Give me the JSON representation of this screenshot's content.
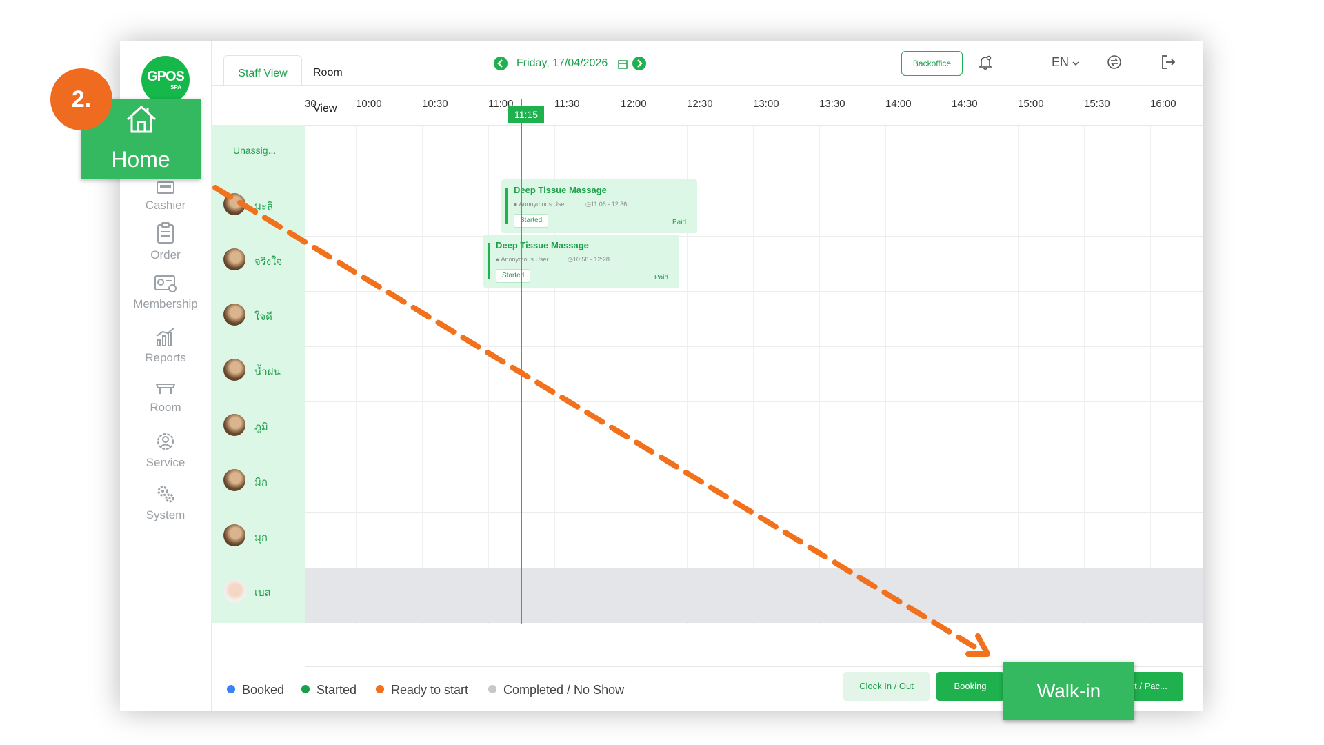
{
  "app": {
    "logo_text": "GPOS",
    "logo_sub": "SPA"
  },
  "sidebar": {
    "items": [
      {
        "label": "Home",
        "icon": "home-icon"
      },
      {
        "label": "Cashier",
        "icon": "cashier-icon"
      },
      {
        "label": "Order",
        "icon": "clipboard-icon"
      },
      {
        "label": "Membership",
        "icon": "membership-card-icon"
      },
      {
        "label": "Reports",
        "icon": "chart-icon"
      },
      {
        "label": "Room",
        "icon": "massage-bed-icon"
      },
      {
        "label": "Service",
        "icon": "service-icon"
      },
      {
        "label": "System",
        "icon": "gears-icon"
      }
    ]
  },
  "header": {
    "tabs": [
      {
        "label": "Staff View",
        "active": true
      },
      {
        "label": "Room View",
        "active": false
      }
    ],
    "date": "Friday, 17/04/2026",
    "backoffice_label": "Backoffice",
    "language": "EN"
  },
  "timeline": {
    "labels": [
      "30",
      "10:00",
      "10:30",
      "11:00",
      "11:30",
      "12:00",
      "12:30",
      "13:00",
      "13:30",
      "14:00",
      "14:30",
      "15:00",
      "15:30",
      "16:00"
    ],
    "current_time": "11:15"
  },
  "staff": {
    "unassigned_label": "Unassig...",
    "members": [
      "มะลิ",
      "จริงใจ",
      "ใจดี",
      "น้ำฝน",
      "ภูมิ",
      "มิก",
      "มุก",
      "เบส"
    ]
  },
  "bookings": [
    {
      "service": "Deep Tissue Massage",
      "client": "Anonymous User",
      "time": "11:06 - 12:36",
      "status": "Started",
      "payment": "Paid"
    },
    {
      "service": "Deep Tissue Massage",
      "client": "Anonymous User",
      "time": "10:58 - 12:28",
      "status": "Started",
      "payment": "Paid"
    }
  ],
  "legend": [
    {
      "label": "Booked",
      "color": "#3b82f6"
    },
    {
      "label": "Started",
      "color": "#15a34a"
    },
    {
      "label": "Ready to start",
      "color": "#f2711c"
    },
    {
      "label": "Completed / No Show",
      "color": "#c8c8c8"
    }
  ],
  "actions": {
    "clock_label": "Clock In / Out",
    "booking_label": "Booking",
    "package_label": "t / Pac..."
  },
  "tutorial": {
    "step": "2.",
    "home_label": "Home",
    "walkin_label": "Walk-in",
    "highlight_color": "#35b960",
    "arrow_color": "#f2711c"
  }
}
